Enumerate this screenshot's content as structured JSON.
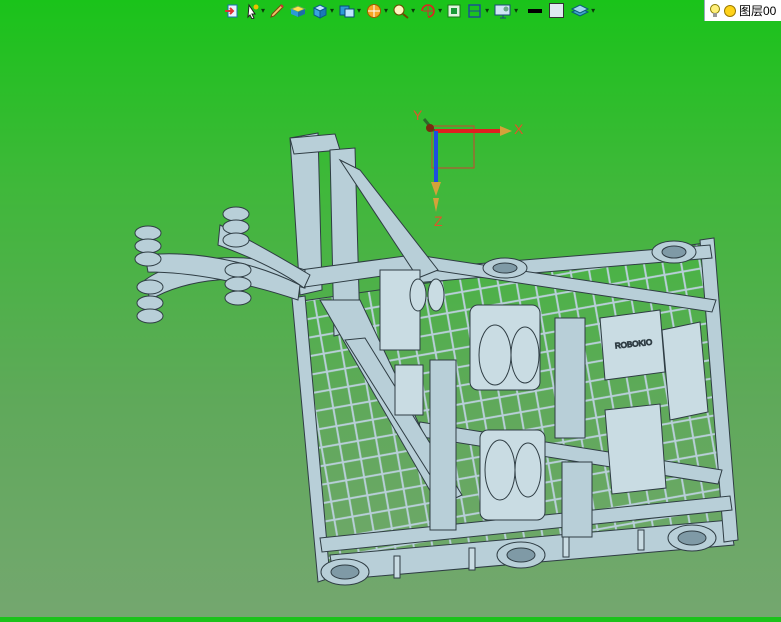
{
  "toolbar": {
    "buttons": [
      {
        "icon": "import-icon",
        "dropdown": false
      },
      {
        "icon": "pointer-select-icon",
        "dropdown": true
      },
      {
        "icon": "sketch-pen-icon",
        "dropdown": false
      },
      {
        "icon": "box-solid-icon",
        "dropdown": false
      },
      {
        "icon": "cube-primitive-icon",
        "dropdown": true
      },
      {
        "icon": "shell-feature-icon",
        "dropdown": true
      },
      {
        "icon": "render-sphere-icon",
        "dropdown": true
      },
      {
        "icon": "zoom-view-icon",
        "dropdown": true
      },
      {
        "icon": "rotate-view-icon",
        "dropdown": true
      },
      {
        "icon": "fit-view-icon",
        "dropdown": false
      },
      {
        "icon": "section-view-icon",
        "dropdown": true
      },
      {
        "icon": "display-settings-icon",
        "dropdown": true
      },
      {
        "icon": "line-color-icon",
        "dropdown": false
      },
      {
        "icon": "face-color-icon",
        "dropdown": false
      },
      {
        "icon": "layer-stack-icon",
        "dropdown": true
      }
    ],
    "layer_label": "图层00",
    "colors": {
      "line_color": "#000000",
      "face_color": "#dfe8f0"
    }
  },
  "axes": {
    "x_label": "X",
    "y_label": "Y",
    "z_label": "Z"
  },
  "model": {
    "nameplate": "ROBOKIO",
    "part_color": "#b8cfd8",
    "edge_color": "#2f3d44"
  }
}
